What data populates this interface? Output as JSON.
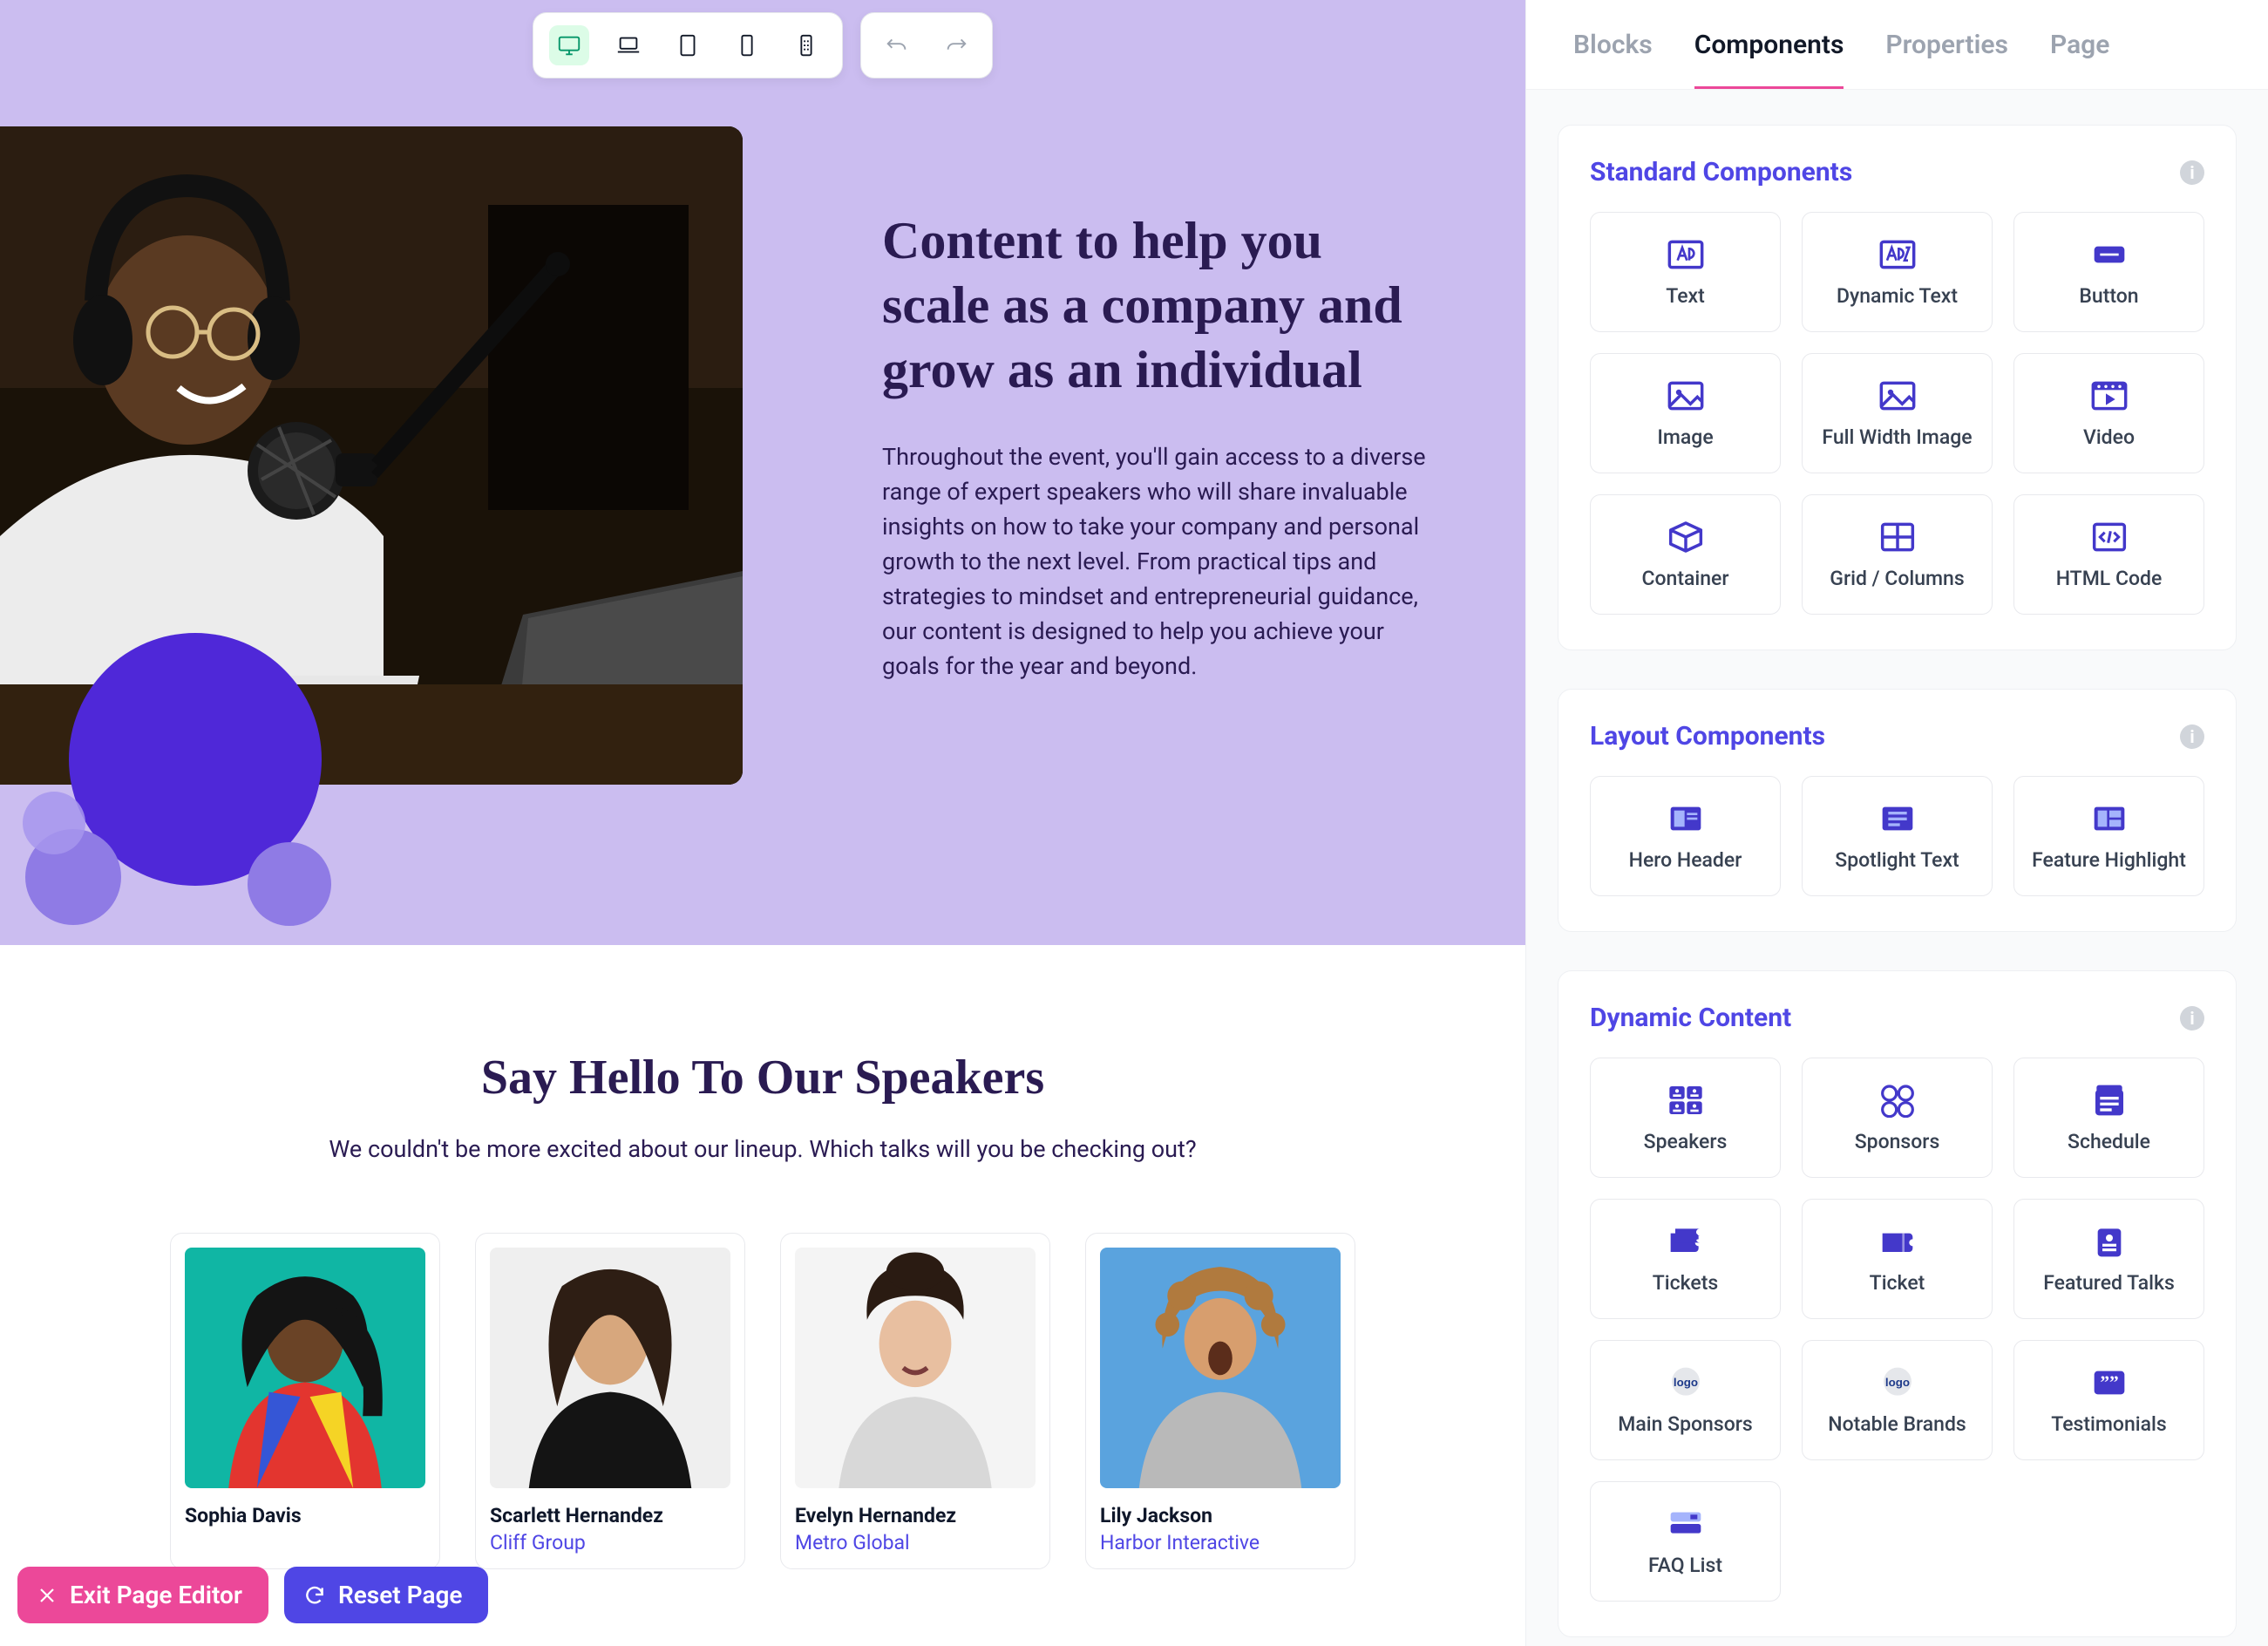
{
  "toolbar": {
    "devices": [
      "desktop",
      "laptop",
      "tablet",
      "phone",
      "custom"
    ],
    "active_device": "desktop"
  },
  "hero": {
    "title": "Content to help you scale as a company and grow as an individual",
    "body": "Throughout the event, you'll gain access to a diverse range of expert speakers who will share invaluable insights on how to take your company and personal growth to the next level. From practical tips and strategies to mindset and entrepreneurial guidance, our content is designed to help you achieve your goals for the year and beyond."
  },
  "speakers": {
    "title": "Say Hello To Our Speakers",
    "sub": "We couldn't be more excited about our lineup. Which talks will you be checking out?",
    "cards": [
      {
        "name": "Sophia Davis",
        "company": ""
      },
      {
        "name": "Scarlett Hernandez",
        "company": "Cliff Group"
      },
      {
        "name": "Evelyn Hernandez",
        "company": "Metro Global"
      },
      {
        "name": "Lily Jackson",
        "company": "Harbor Interactive"
      }
    ]
  },
  "editor_bar": {
    "exit": "Exit Page Editor",
    "reset": "Reset Page"
  },
  "panel": {
    "tabs": [
      {
        "id": "blocks",
        "label": "Blocks"
      },
      {
        "id": "components",
        "label": "Components"
      },
      {
        "id": "properties",
        "label": "Properties"
      },
      {
        "id": "page",
        "label": "Page"
      }
    ],
    "active_tab": "components",
    "sections": [
      {
        "title": "Standard Components",
        "items": [
          {
            "icon": "text",
            "label": "Text"
          },
          {
            "icon": "dyn-text",
            "label": "Dynamic Text"
          },
          {
            "icon": "button",
            "label": "Button"
          },
          {
            "icon": "image",
            "label": "Image"
          },
          {
            "icon": "image",
            "label": "Full Width Image"
          },
          {
            "icon": "video",
            "label": "Video"
          },
          {
            "icon": "container",
            "label": "Container"
          },
          {
            "icon": "grid",
            "label": "Grid / Columns"
          },
          {
            "icon": "code",
            "label": "HTML Code"
          }
        ]
      },
      {
        "title": "Layout Components",
        "items": [
          {
            "icon": "hero",
            "label": "Hero Header"
          },
          {
            "icon": "spotlight",
            "label": "Spotlight Text"
          },
          {
            "icon": "feature",
            "label": "Feature Highlight"
          }
        ]
      },
      {
        "title": "Dynamic Content",
        "items": [
          {
            "icon": "speakers",
            "label": "Speakers"
          },
          {
            "icon": "sponsors",
            "label": "Sponsors"
          },
          {
            "icon": "schedule",
            "label": "Schedule"
          },
          {
            "icon": "tickets",
            "label": "Tickets"
          },
          {
            "icon": "ticket",
            "label": "Ticket"
          },
          {
            "icon": "featured",
            "label": "Featured Talks"
          },
          {
            "icon": "logo",
            "label": "Main Sponsors"
          },
          {
            "icon": "logo",
            "label": "Notable Brands"
          },
          {
            "icon": "testi",
            "label": "Testimonials"
          },
          {
            "icon": "faq",
            "label": "FAQ List"
          }
        ]
      }
    ]
  }
}
